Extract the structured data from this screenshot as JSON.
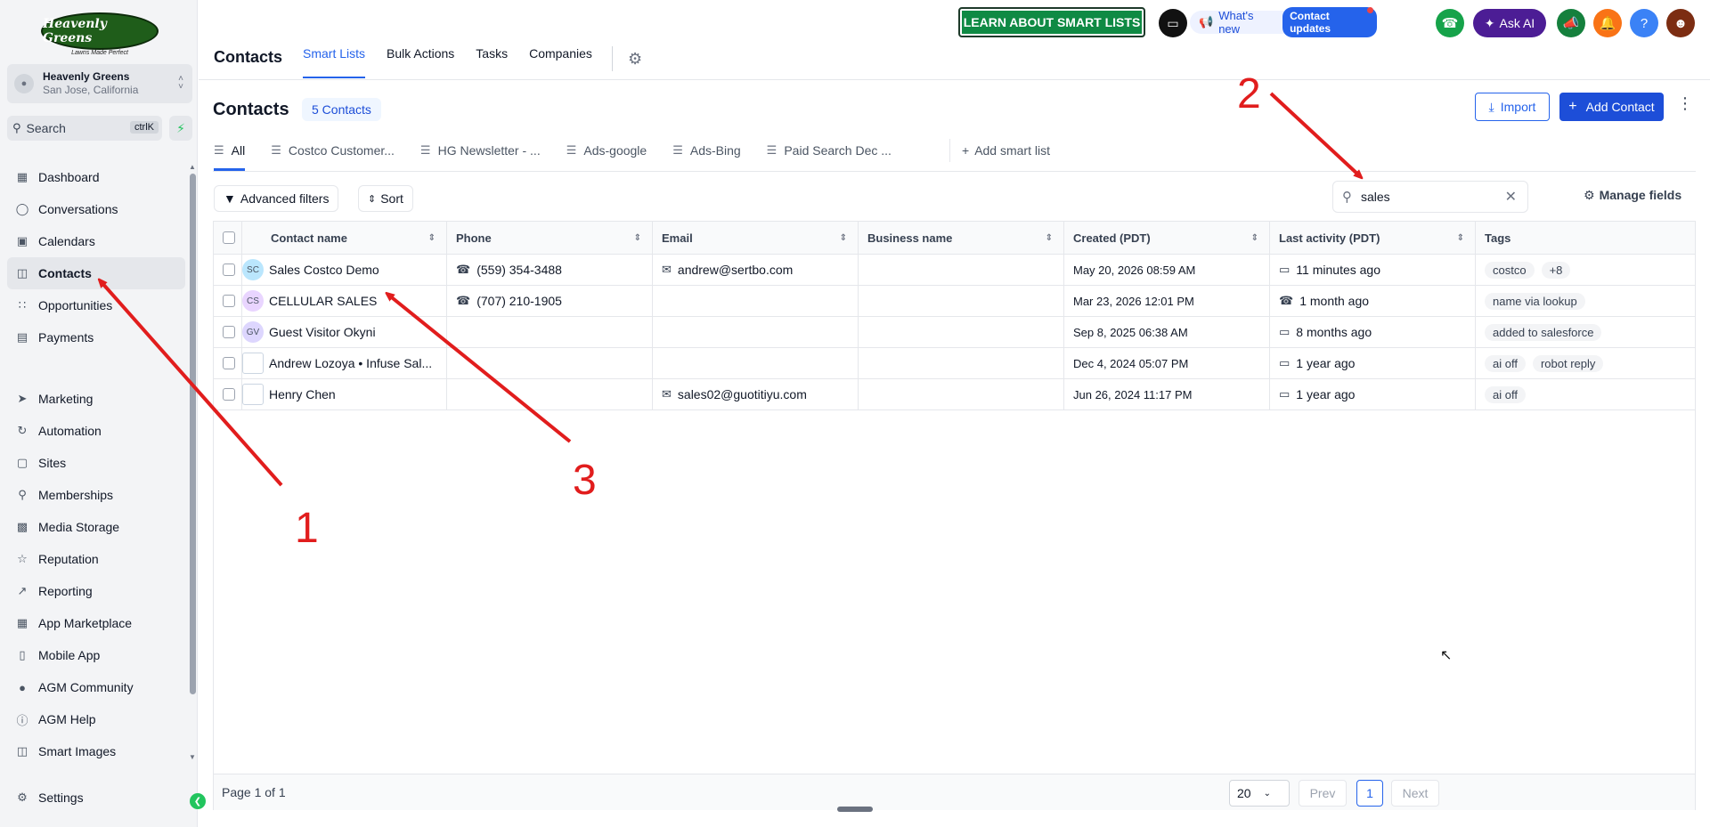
{
  "brand": {
    "logo_text": "Heavenly Greens",
    "logo_tagline": "Lawns Made Perfect"
  },
  "account": {
    "name": "Heavenly Greens",
    "location": "San Jose, California"
  },
  "sidebar_search": {
    "placeholder": "Search",
    "shortcut": "ctrlK"
  },
  "sidebar": {
    "items": [
      {
        "label": "Dashboard",
        "icon": "grid-icon"
      },
      {
        "label": "Conversations",
        "icon": "chat-bubble-icon"
      },
      {
        "label": "Calendars",
        "icon": "calendar-icon"
      },
      {
        "label": "Contacts",
        "icon": "contacts-book-icon"
      },
      {
        "label": "Opportunities",
        "icon": "pipeline-icon"
      },
      {
        "label": "Payments",
        "icon": "receipt-icon"
      }
    ],
    "items2": [
      {
        "label": "Marketing",
        "icon": "send-icon"
      },
      {
        "label": "Automation",
        "icon": "automation-icon"
      },
      {
        "label": "Sites",
        "icon": "globe-icon"
      },
      {
        "label": "Memberships",
        "icon": "graduation-icon"
      },
      {
        "label": "Media Storage",
        "icon": "image-icon"
      },
      {
        "label": "Reputation",
        "icon": "star-icon"
      },
      {
        "label": "Reporting",
        "icon": "trend-icon"
      },
      {
        "label": "App Marketplace",
        "icon": "apps-icon"
      },
      {
        "label": "Mobile App",
        "icon": "mobile-icon"
      },
      {
        "label": "AGM Community",
        "icon": "people-icon"
      },
      {
        "label": "AGM Help",
        "icon": "info-icon"
      },
      {
        "label": "Smart Images",
        "icon": "book-icon"
      }
    ],
    "settings": "Settings"
  },
  "header": {
    "title": "Contacts",
    "tabs": [
      "Smart Lists",
      "Bulk Actions",
      "Tasks",
      "Companies"
    ],
    "learn_button": "LEARN ABOUT SMART LISTS",
    "whats_new": "What's new",
    "contact_updates": "Contact updates",
    "ask_ai": "Ask AI",
    "colors": {
      "accent": "#2563eb",
      "learn_green": "#0f8a44",
      "ai_purple": "#4c1d95"
    }
  },
  "main": {
    "heading": "Contacts",
    "count_badge": "5 Contacts",
    "import_label": "Import",
    "add_contact_label": "Add Contact",
    "list_tabs": [
      "All",
      "Costco Customer...",
      "HG Newsletter - ...",
      "Ads-google",
      "Ads-Bing",
      "Paid Search Dec ..."
    ],
    "add_smart_list": "Add smart list",
    "advanced_filters": "Advanced filters",
    "sort": "Sort",
    "search_value": "sales",
    "manage_fields": "Manage fields"
  },
  "table": {
    "columns": [
      "Contact name",
      "Phone",
      "Email",
      "Business name",
      "Created (PDT)",
      "Last activity (PDT)",
      "Tags"
    ],
    "rows": [
      {
        "initials": "SC",
        "avatar_color": "#bae6fd",
        "name": "Sales Costco Demo",
        "phone": "(559) 354-3488",
        "email": "andrew@sertbo.com",
        "business": "",
        "created": "May 20, 2026 08:59 AM",
        "activity_icon": "chat",
        "activity": "11 minutes ago",
        "tags": [
          "costco",
          "+8"
        ]
      },
      {
        "initials": "CS",
        "avatar_color": "#e9d5ff",
        "name": "CELLULAR SALES",
        "phone": "(707) 210-1905",
        "email": "",
        "business": "",
        "created": "Mar 23, 2026 12:01 PM",
        "activity_icon": "phone",
        "activity": "1 month ago",
        "tags": [
          "name via lookup"
        ]
      },
      {
        "initials": "GV",
        "avatar_color": "#ddd6fe",
        "name": "Guest Visitor Okyni",
        "phone": "",
        "email": "",
        "business": "",
        "created": "Sep 8, 2025 06:38 AM",
        "activity_icon": "chat",
        "activity": "8 months ago",
        "tags": [
          "added to salesforce"
        ]
      },
      {
        "initials": "",
        "avatar_color": "img",
        "name": "Andrew Lozoya • Infuse Sal...",
        "phone": "",
        "email": "",
        "business": "",
        "created": "Dec 4, 2024 05:07 PM",
        "activity_icon": "chat",
        "activity": "1 year ago",
        "tags": [
          "ai off",
          "robot reply"
        ]
      },
      {
        "initials": "",
        "avatar_color": "img",
        "name": "Henry Chen",
        "phone": "",
        "email": "sales02@guotitiyu.com",
        "business": "",
        "created": "Jun 26, 2024 11:17 PM",
        "activity_icon": "chat",
        "activity": "1 year ago",
        "tags": [
          "ai off"
        ]
      }
    ]
  },
  "pager": {
    "page_text": "Page 1 of 1",
    "per_page": "20",
    "prev": "Prev",
    "current": "1",
    "next": "Next"
  },
  "annotations": {
    "label_1": "1",
    "label_2": "2",
    "label_3": "3",
    "color": "#e11d1d"
  }
}
